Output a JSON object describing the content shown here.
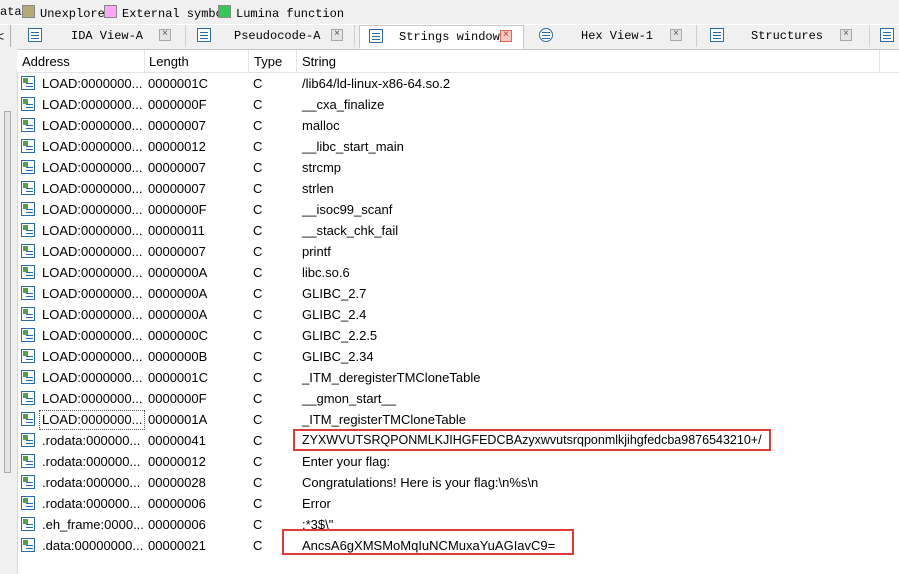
{
  "legend": [
    {
      "label": "ata",
      "color": ""
    },
    {
      "label": "Unexplored",
      "color": "#b5a979"
    },
    {
      "label": "External symbol",
      "color": "#ffa8f3"
    },
    {
      "label": "Lumina function",
      "color": "#35c852"
    }
  ],
  "left_border_arrow": "<",
  "tabs": [
    {
      "label": "IDA View-A",
      "active": false
    },
    {
      "label": "Pseudocode-A",
      "active": false
    },
    {
      "label": "Strings window",
      "active": true
    },
    {
      "label": "Hex View-1",
      "active": false
    },
    {
      "label": "Structures",
      "active": false
    }
  ],
  "columns": [
    "Address",
    "Length",
    "Type",
    "String"
  ],
  "rows": [
    {
      "address": "LOAD:0000000...",
      "length": "0000001C",
      "type": "C",
      "string": "/lib64/ld-linux-x86-64.so.2"
    },
    {
      "address": "LOAD:0000000...",
      "length": "0000000F",
      "type": "C",
      "string": "__cxa_finalize"
    },
    {
      "address": "LOAD:0000000...",
      "length": "00000007",
      "type": "C",
      "string": "malloc"
    },
    {
      "address": "LOAD:0000000...",
      "length": "00000012",
      "type": "C",
      "string": "__libc_start_main"
    },
    {
      "address": "LOAD:0000000...",
      "length": "00000007",
      "type": "C",
      "string": "strcmp"
    },
    {
      "address": "LOAD:0000000...",
      "length": "00000007",
      "type": "C",
      "string": "strlen"
    },
    {
      "address": "LOAD:0000000...",
      "length": "0000000F",
      "type": "C",
      "string": "__isoc99_scanf"
    },
    {
      "address": "LOAD:0000000...",
      "length": "00000011",
      "type": "C",
      "string": "__stack_chk_fail"
    },
    {
      "address": "LOAD:0000000...",
      "length": "00000007",
      "type": "C",
      "string": "printf"
    },
    {
      "address": "LOAD:0000000...",
      "length": "0000000A",
      "type": "C",
      "string": "libc.so.6"
    },
    {
      "address": "LOAD:0000000...",
      "length": "0000000A",
      "type": "C",
      "string": "GLIBC_2.7"
    },
    {
      "address": "LOAD:0000000...",
      "length": "0000000A",
      "type": "C",
      "string": "GLIBC_2.4"
    },
    {
      "address": "LOAD:0000000...",
      "length": "0000000C",
      "type": "C",
      "string": "GLIBC_2.2.5"
    },
    {
      "address": "LOAD:0000000...",
      "length": "0000000B",
      "type": "C",
      "string": "GLIBC_2.34"
    },
    {
      "address": "LOAD:0000000...",
      "length": "0000001C",
      "type": "C",
      "string": "_ITM_deregisterTMCloneTable"
    },
    {
      "address": "LOAD:0000000...",
      "length": "0000000F",
      "type": "C",
      "string": "__gmon_start__"
    },
    {
      "address": "LOAD:0000000...",
      "length": "0000001A",
      "type": "C",
      "string": "_ITM_registerTMCloneTable"
    },
    {
      "address": ".rodata:000000...",
      "length": "00000041",
      "type": "C",
      "string": "ZYXWVUTSRQPONMLKJIHGFEDCBAzyxwvutsrqponmlkjihgfedcba9876543210+/"
    },
    {
      "address": ".rodata:000000...",
      "length": "00000012",
      "type": "C",
      "string": "Enter your flag:"
    },
    {
      "address": ".rodata:000000...",
      "length": "00000028",
      "type": "C",
      "string": "Congratulations! Here is your flag:\\n%s\\n"
    },
    {
      "address": ".rodata:000000...",
      "length": "00000006",
      "type": "C",
      "string": "Error"
    },
    {
      "address": ".eh_frame:0000...",
      "length": "00000006",
      "type": "C",
      "string": ":*3$\\\""
    },
    {
      "address": ".data:00000000...",
      "length": "00000021",
      "type": "C",
      "string": "AncsA6gXMSMoMqIuNCMuxaYuAGIavC9="
    }
  ]
}
